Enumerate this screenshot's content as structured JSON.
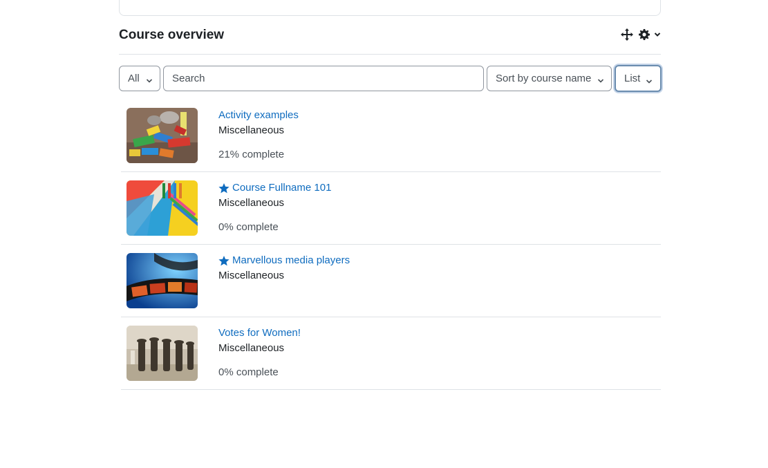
{
  "block": {
    "title": "Course overview",
    "move_icon": "move-icon",
    "settings_icon": "gear-icon"
  },
  "filters": {
    "grouping": "All",
    "search_placeholder": "Search",
    "search_value": "",
    "sort": "Sort by course name",
    "view": "List"
  },
  "colors": {
    "link": "#0f6cbf",
    "border": "#dee2e6",
    "focus": "#6a8cae"
  },
  "courses": [
    {
      "title": "Activity examples",
      "starred": false,
      "category": "Miscellaneous",
      "progress": "21% complete",
      "image": "building-blocks"
    },
    {
      "title": "Course Fullname 101",
      "starred": true,
      "category": "Miscellaneous",
      "progress": "0% complete",
      "image": "stationery"
    },
    {
      "title": "Marvellous media players",
      "starred": true,
      "category": "Miscellaneous",
      "progress": "",
      "image": "film-strip"
    },
    {
      "title": "Votes for Women!",
      "starred": false,
      "category": "Miscellaneous",
      "progress": "0% complete",
      "image": "suffragettes-photo"
    }
  ]
}
